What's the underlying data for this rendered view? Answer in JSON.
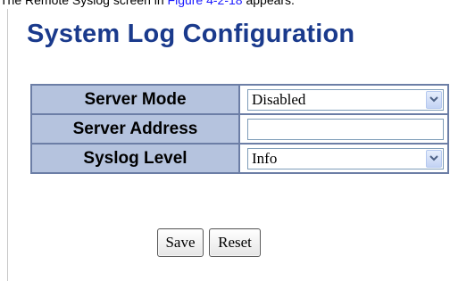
{
  "caption": {
    "prefix": "The Remote Syslog screen in ",
    "link": "Figure 4-2-18",
    "suffix": " appears."
  },
  "page": {
    "title": "System Log Configuration"
  },
  "form": {
    "server_mode": {
      "label": "Server Mode",
      "value": "Disabled"
    },
    "server_address": {
      "label": "Server Address",
      "value": ""
    },
    "syslog_level": {
      "label": "Syslog Level",
      "value": "Info"
    }
  },
  "buttons": {
    "save": "Save",
    "reset": "Reset"
  },
  "colors": {
    "title": "#1a3a8c",
    "label_bg": "#b5c3de",
    "border": "#6c7ea6"
  },
  "icons": {
    "dropdown": "chevron-down-icon"
  }
}
